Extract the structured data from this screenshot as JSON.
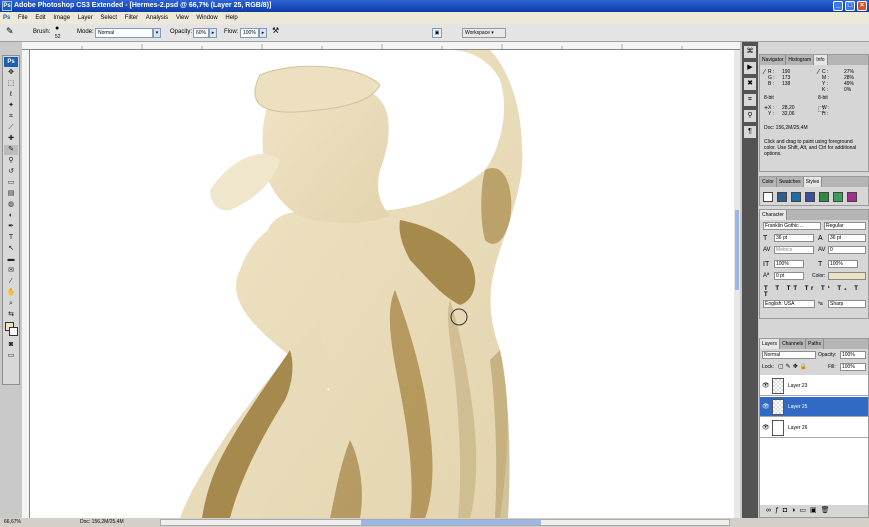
{
  "app": {
    "title": "Adobe Photoshop CS3 Extended - [Hermes-2.psd @ 66,7% (Layer 25, RGB/8)]",
    "logo": "Ps"
  },
  "menu": [
    "File",
    "Edit",
    "Image",
    "Layer",
    "Select",
    "Filter",
    "Analysis",
    "View",
    "Window",
    "Help"
  ],
  "options": {
    "brush_label": "Brush:",
    "brush_size": "52",
    "mode_label": "Mode:",
    "mode_value": "Normal",
    "opacity_label": "Opacity:",
    "opacity_value": "60%",
    "flow_label": "Flow:",
    "flow_value": "100%",
    "workspace_label": "Workspace"
  },
  "status": {
    "zoom": "66,67%",
    "doc": "Doc: 156,2M/25,4M"
  },
  "info_panel": {
    "tabs": [
      "Navigator",
      "Histogram",
      "Info"
    ],
    "active_tab": "Info",
    "rgb": [
      [
        "R :",
        "190"
      ],
      [
        "G :",
        "173"
      ],
      [
        "B :",
        "138"
      ]
    ],
    "cmyk": [
      [
        "C :",
        "27%"
      ],
      [
        "M :",
        "28%"
      ],
      [
        "Y :",
        "49%"
      ],
      [
        "K :",
        "0%"
      ]
    ],
    "bit_left": "8-bit",
    "bit_right": "8-bit",
    "xy": [
      [
        "X :",
        "28,20"
      ],
      [
        "Y :",
        "32,06"
      ]
    ],
    "wh": [
      [
        "W :",
        ""
      ],
      [
        "H :",
        ""
      ]
    ],
    "doc": "Doc: 156,2M/25,4M",
    "hint": "Click and drag to paint using foreground color. Use Shift, Alt, and Ctrl for additional options."
  },
  "styles_panel": {
    "tabs": [
      "Color",
      "Swatches",
      "Styles"
    ],
    "active_tab": "Styles"
  },
  "character_panel": {
    "tab": "Character",
    "font_family": "Franklin Gothic ...",
    "font_style": "Regular",
    "font_size": "36 pt",
    "leading": "36 pt",
    "kerning": "Metrics",
    "tracking": "0",
    "vertical_scale": "100%",
    "horizontal_scale": "100%",
    "baseline": "0 pt",
    "color_label": "Color:",
    "language": "English: USA",
    "antialias": "Sharp",
    "type_buttons": [
      "T",
      "T",
      "TT",
      "Tr",
      "T¹",
      "T₁",
      "T",
      "T"
    ]
  },
  "layers_panel": {
    "tabs": [
      "Layers",
      "Channels",
      "Paths"
    ],
    "blend_mode": "Normal",
    "opacity_label": "Opacity:",
    "opacity": "100%",
    "lock_label": "Lock:",
    "fill_label": "Fill:",
    "fill": "100%",
    "layers": [
      {
        "name": "Layer 23",
        "selected": false
      },
      {
        "name": "Layer 25",
        "selected": true
      },
      {
        "name": "Layer 26",
        "selected": false
      }
    ]
  },
  "colors": {
    "statue_light": "#eee2c2",
    "statue_mid": "#d5c49a",
    "statue_shadow": "#9a7a3a",
    "selection": "#316ac5"
  }
}
